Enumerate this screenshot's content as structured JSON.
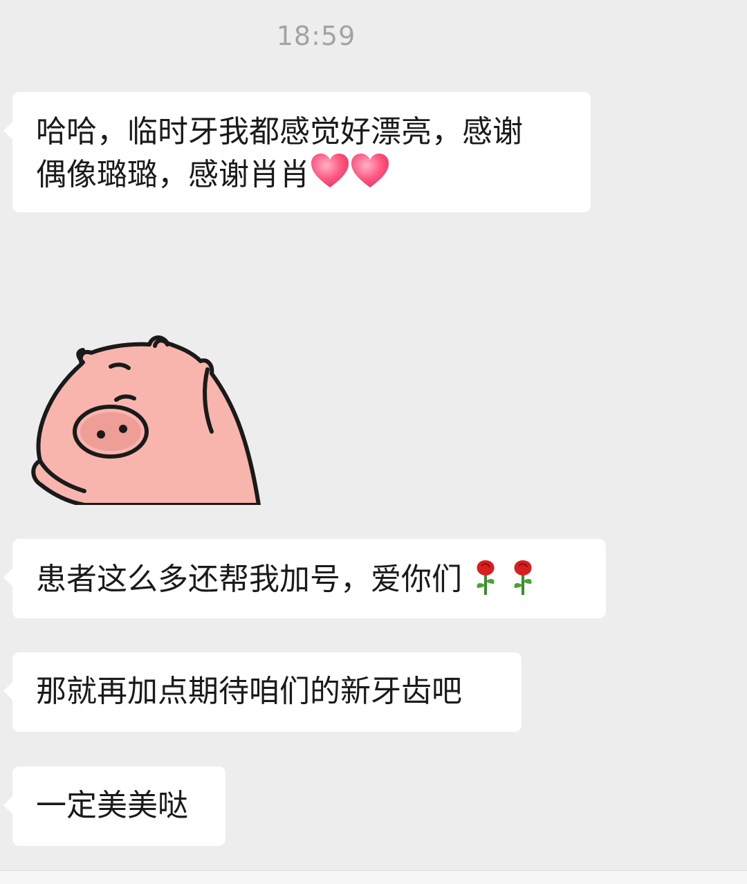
{
  "chat": {
    "timestamp": "18:59",
    "messages": [
      {
        "line1": "哈哈，临时牙我都感觉好漂亮，感谢",
        "line2": "偶像璐璐，感谢肖肖",
        "emoji": "heart-icon"
      },
      {
        "type": "sticker",
        "sticker": "pig-sticker"
      },
      {
        "text": "患者这么多还帮我加号，爱你们",
        "emoji": "rose-icon"
      },
      {
        "text": "那就再加点期待咱们的新牙齿吧"
      },
      {
        "text": "一定美美哒"
      }
    ]
  },
  "colors": {
    "background": "#ededed",
    "bubble": "#ffffff",
    "timestamp": "#a3a3a3",
    "heart": "#ff4f7a",
    "rose": "#d81e1e",
    "pig": "#f7b5ae"
  }
}
